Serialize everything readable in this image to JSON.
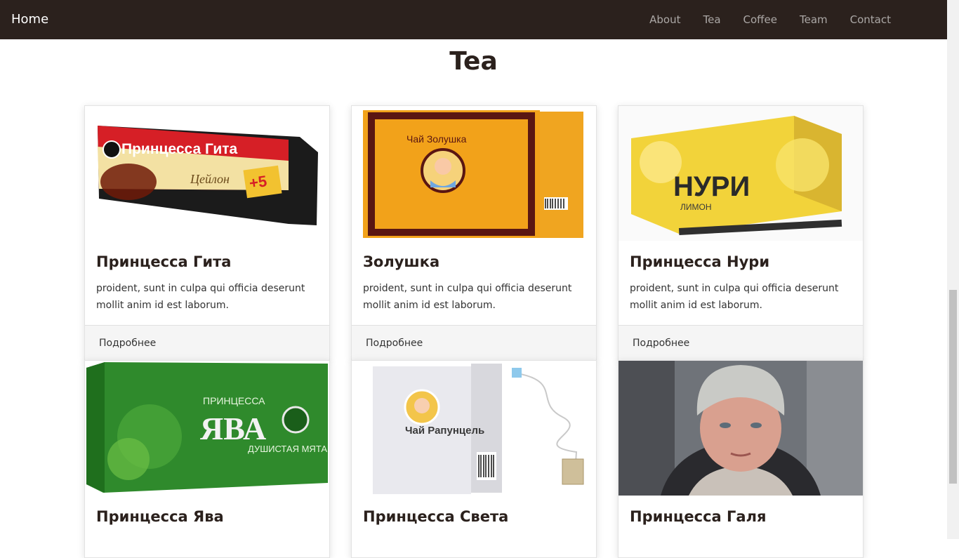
{
  "nav": {
    "brand": "Home",
    "links": [
      "About",
      "Tea",
      "Coffee",
      "Team",
      "Contact"
    ]
  },
  "section": {
    "title": "Tea"
  },
  "cards": [
    {
      "title": "Принцесса Гита",
      "text": "proident, sunt in culpa qui officia deserunt mollit anim id est laborum.",
      "more": "Подробнее",
      "image": {
        "icon": "tea-box-red",
        "label": "Принцесса Гита",
        "sub": "Цейлон",
        "color": "#d61f26"
      }
    },
    {
      "title": "Золушка",
      "text": "proident, sunt in culpa qui officia deserunt mollit anim id est laborum.",
      "more": "Подробнее",
      "image": {
        "icon": "tea-box-orange",
        "label": "Чай Золушка",
        "color": "#f2a21a"
      }
    },
    {
      "title": "Принцесса Нури",
      "text": "proident, sunt in culpa qui officia deserunt mollit anim id est laborum.",
      "more": "Подробнее",
      "image": {
        "icon": "tea-box-yellow",
        "label": "НУРИ",
        "sub": "ЛИМОН",
        "color": "#f2d33a"
      }
    },
    {
      "title": "Принцесса Ява",
      "image": {
        "icon": "tea-box-green",
        "label": "ЯВА",
        "sub": "ДУШИСТАЯ МЯТА",
        "top": "ПРИНЦЕССА",
        "color": "#2f8a2c"
      }
    },
    {
      "title": "Принцесса Света",
      "image": {
        "icon": "tea-box-white",
        "label": "Чай Рапунцель",
        "color": "#e9e9ee"
      }
    },
    {
      "title": "Принцесса Галя",
      "image": {
        "icon": "portrait-photo"
      }
    }
  ]
}
